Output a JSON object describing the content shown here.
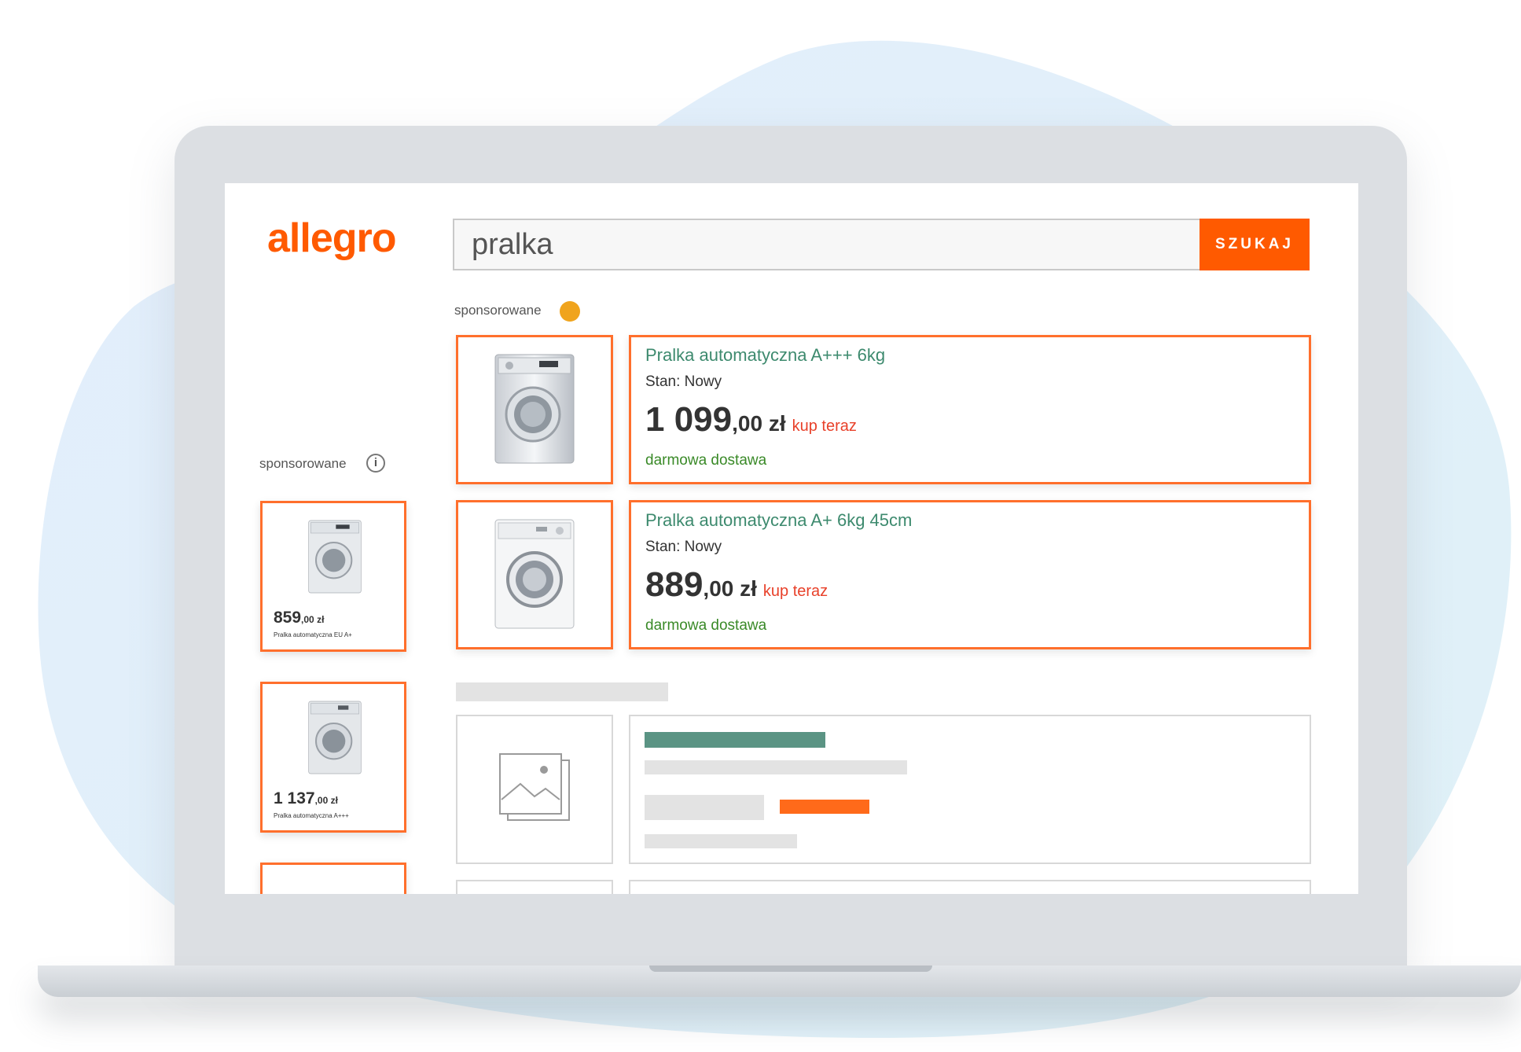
{
  "search": {
    "query": "pralka",
    "button_label": "SZUKAJ"
  },
  "brand": {
    "logo_text": "allegro",
    "accent": "#ff5a00"
  },
  "sponsored_label_main": "sponsorowane",
  "sponsored_label_side": "sponsorowane",
  "products": [
    {
      "title": "Pralka automatyczna A+++ 6kg",
      "condition": "Stan: Nowy",
      "price_main": "1 099",
      "price_cents": ",00 zł",
      "buy_label": "kup teraz",
      "shipping": "darmowa dostawa",
      "icon": "washing-machine-icon"
    },
    {
      "title": "Pralka automatyczna A+ 6kg 45cm",
      "condition": "Stan: Nowy",
      "price_main": "889",
      "price_cents": ",00 zł",
      "buy_label": "kup teraz",
      "shipping": "darmowa dostawa",
      "icon": "washing-machine-icon"
    }
  ],
  "side_products": [
    {
      "price_main": "859",
      "price_cents": ",00 zł",
      "title": "Pralka automatyczna EU A+"
    },
    {
      "price_main": "1 137",
      "price_cents": ",00 zł",
      "title": "Pralka automatyczna A+++"
    }
  ],
  "colors": {
    "title_green": "#3d8a6e",
    "shipping_green": "#3a8a28",
    "buy_red": "#e8412a",
    "card_border": "#ff6f2c",
    "sponsored_dot": "#f0a41d",
    "placeholder_bar_green": "#5b9484",
    "placeholder_bar_orange": "#ff6a1a",
    "placeholder_bar_gray": "#e3e3e3"
  }
}
